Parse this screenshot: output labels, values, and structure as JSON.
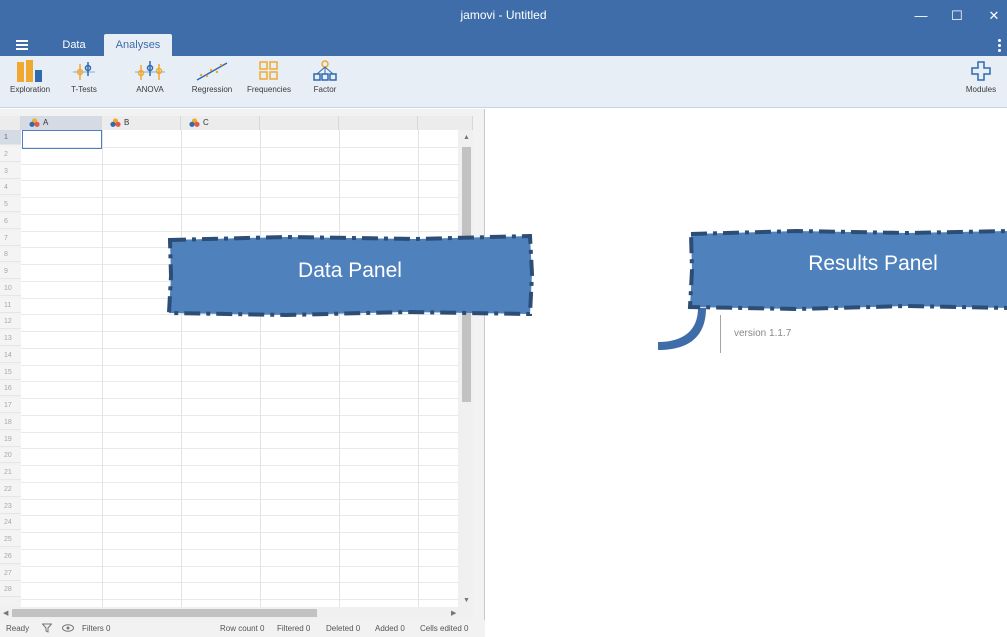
{
  "window": {
    "title": "jamovi - Untitled",
    "minimize_glyph": "—",
    "maximize_glyph": "☐",
    "close_glyph": "✕"
  },
  "tabs": [
    {
      "label": "Data"
    },
    {
      "label": "Analyses"
    }
  ],
  "ribbon": [
    {
      "label": "Exploration",
      "icon": "exploration-icon"
    },
    {
      "label": "T-Tests",
      "icon": "t-tests-icon"
    },
    {
      "label": "ANOVA",
      "icon": "anova-icon"
    },
    {
      "label": "Regression",
      "icon": "regression-icon"
    },
    {
      "label": "Frequencies",
      "icon": "frequencies-icon"
    },
    {
      "label": "Factor",
      "icon": "factor-icon"
    },
    {
      "label": "Modules",
      "icon": "modules-plus-icon"
    }
  ],
  "columns": [
    {
      "label": "A"
    },
    {
      "label": "B"
    },
    {
      "label": "C"
    }
  ],
  "rows": [
    "1",
    "2",
    "3",
    "4",
    "5",
    "6",
    "7",
    "8",
    "9",
    "10",
    "11",
    "12",
    "13",
    "14",
    "15",
    "16",
    "17",
    "18",
    "19",
    "20",
    "21",
    "22",
    "23",
    "24",
    "25",
    "26",
    "27",
    "28"
  ],
  "status": {
    "ready": "Ready",
    "filters": "Filters 0",
    "row_count": "Row count 0",
    "filtered": "Filtered 0",
    "deleted": "Deleted 0",
    "added": "Added 0",
    "cells_edited": "Cells edited 0"
  },
  "results": {
    "version": "version 1.1.7"
  },
  "annotations": {
    "data_panel": "Data Panel",
    "results_panel": "Results Panel"
  },
  "colors": {
    "titlebar": "#3e6da9",
    "ribbon_bg": "#e8eef6",
    "accent_orange": "#f0a830",
    "callout_fill": "#4f81bd",
    "callout_border": "#2c4d75"
  }
}
